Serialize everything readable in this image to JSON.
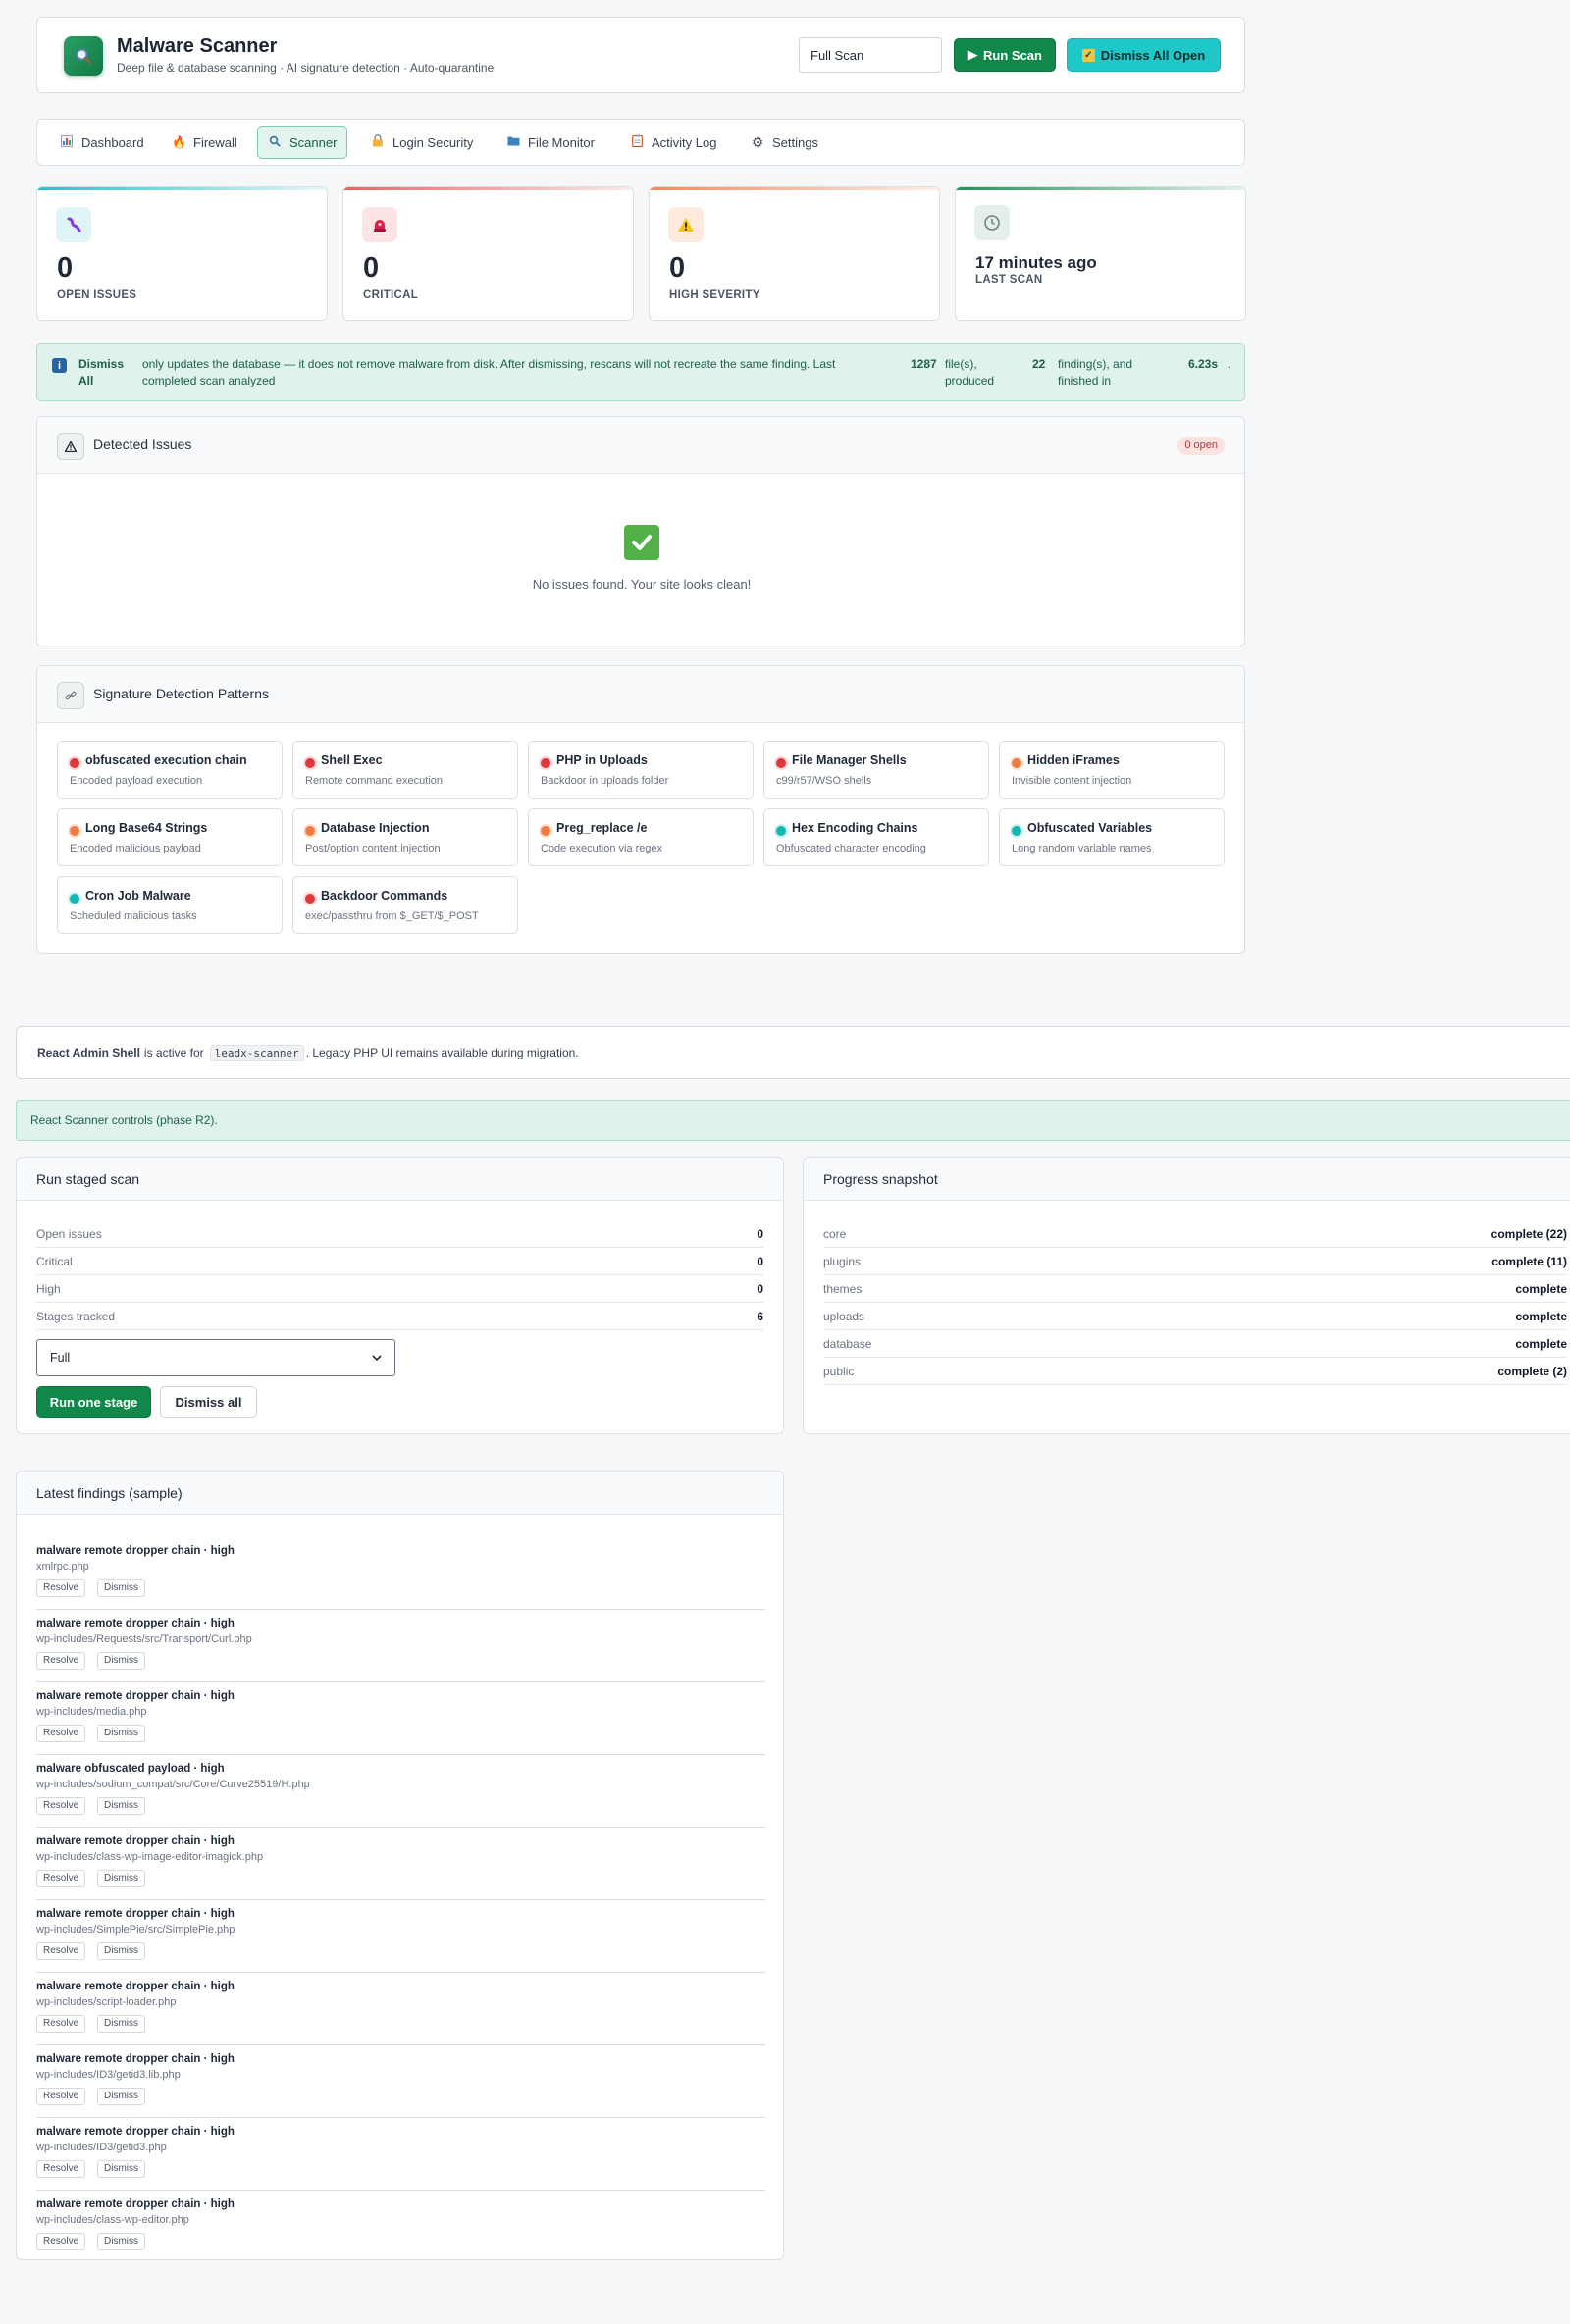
{
  "header": {
    "title": "Malware Scanner",
    "subtitle": "Deep file & database scanning · AI signature detection · Auto-quarantine",
    "scan_type_value": "Full Scan",
    "run_scan_label": "Run Scan",
    "dismiss_all_open_label": "Dismiss All Open"
  },
  "tabs": [
    {
      "label": "Dashboard",
      "icon": "chart-icon",
      "active": false
    },
    {
      "label": "Firewall",
      "icon": "fire-icon",
      "active": false
    },
    {
      "label": "Scanner",
      "icon": "search-icon",
      "active": true
    },
    {
      "label": "Login Security",
      "icon": "lock-icon",
      "active": false
    },
    {
      "label": "File Monitor",
      "icon": "folder-icon",
      "active": false
    },
    {
      "label": "Activity Log",
      "icon": "clipboard-icon",
      "active": false
    },
    {
      "label": "Settings",
      "icon": "gear-icon",
      "active": false
    }
  ],
  "stats": [
    {
      "value": "0",
      "label": "OPEN ISSUES",
      "accent": "#20c4cf"
    },
    {
      "value": "0",
      "label": "CRITICAL",
      "accent": "#e86464"
    },
    {
      "value": "0",
      "label": "HIGH SEVERITY",
      "accent": "#f08a5d"
    },
    {
      "value": "17 minutes ago",
      "label": "LAST SCAN",
      "accent": "#23915a"
    }
  ],
  "banner": {
    "lead": "Dismiss All",
    "text": "only updates the database — it does not remove malware from disk. After dismissing, rescans will not recreate the same finding. Last completed scan analyzed",
    "files_count": "1287",
    "files_text": "file(s), produced",
    "findings_count": "22",
    "findings_text": "finding(s), and finished in",
    "duration": "6.23s",
    "end": "."
  },
  "issues": {
    "title": "Detected Issues",
    "badge": "0 open",
    "empty_text": "No issues found. Your site looks clean!"
  },
  "patterns": {
    "title": "Signature Detection Patterns",
    "items": [
      {
        "name": "obfuscated execution chain",
        "desc": "Encoded payload execution",
        "severity": "critical"
      },
      {
        "name": "Shell Exec",
        "desc": "Remote command execution",
        "severity": "critical"
      },
      {
        "name": "PHP in Uploads",
        "desc": "Backdoor in uploads folder",
        "severity": "critical"
      },
      {
        "name": "File Manager Shells",
        "desc": "c99/r57/WSO shells",
        "severity": "critical"
      },
      {
        "name": "Hidden iFrames",
        "desc": "Invisible content injection",
        "severity": "high"
      },
      {
        "name": "Long Base64 Strings",
        "desc": "Encoded malicious payload",
        "severity": "high"
      },
      {
        "name": "Database Injection",
        "desc": "Post/option content injection",
        "severity": "high"
      },
      {
        "name": "Preg_replace /e",
        "desc": "Code execution via regex",
        "severity": "high"
      },
      {
        "name": "Hex Encoding Chains",
        "desc": "Obfuscated character encoding",
        "severity": "medium"
      },
      {
        "name": "Obfuscated Variables",
        "desc": "Long random variable names",
        "severity": "medium"
      },
      {
        "name": "Cron Job Malware",
        "desc": "Scheduled malicious tasks",
        "severity": "medium"
      },
      {
        "name": "Backdoor Commands",
        "desc": "exec/passthru from $_GET/$_POST",
        "severity": "critical"
      }
    ]
  },
  "react_shell": {
    "strong": "React Admin Shell",
    "mid": "is active for",
    "code": "leadx-scanner",
    "tail": ". Legacy PHP UI remains available during migration."
  },
  "phase_note": "React Scanner controls (phase R2).",
  "staged_scan": {
    "title": "Run staged scan",
    "rows": [
      {
        "key": "Open issues",
        "value": "0"
      },
      {
        "key": "Critical",
        "value": "0"
      },
      {
        "key": "High",
        "value": "0"
      },
      {
        "key": "Stages tracked",
        "value": "6"
      }
    ],
    "select_value": "Full",
    "run_one_stage_label": "Run one stage",
    "dismiss_all_label": "Dismiss all"
  },
  "progress": {
    "title": "Progress snapshot",
    "rows": [
      {
        "key": "core",
        "value": "complete (22)"
      },
      {
        "key": "plugins",
        "value": "complete (11)"
      },
      {
        "key": "themes",
        "value": "complete"
      },
      {
        "key": "uploads",
        "value": "complete"
      },
      {
        "key": "database",
        "value": "complete"
      },
      {
        "key": "public",
        "value": "complete (2)"
      }
    ]
  },
  "findings": {
    "title": "Latest findings (sample)",
    "resolve_label": "Resolve",
    "dismiss_label": "Dismiss",
    "items": [
      {
        "title": "malware remote dropper chain · high",
        "path": "xmlrpc.php"
      },
      {
        "title": "malware remote dropper chain · high",
        "path": "wp-includes/Requests/src/Transport/Curl.php"
      },
      {
        "title": "malware remote dropper chain · high",
        "path": "wp-includes/media.php"
      },
      {
        "title": "malware obfuscated payload · high",
        "path": "wp-includes/sodium_compat/src/Core/Curve25519/H.php"
      },
      {
        "title": "malware remote dropper chain · high",
        "path": "wp-includes/class-wp-image-editor-imagick.php"
      },
      {
        "title": "malware remote dropper chain · high",
        "path": "wp-includes/SimplePie/src/SimplePie.php"
      },
      {
        "title": "malware remote dropper chain · high",
        "path": "wp-includes/script-loader.php"
      },
      {
        "title": "malware remote dropper chain · high",
        "path": "wp-includes/ID3/getid3.lib.php"
      },
      {
        "title": "malware remote dropper chain · high",
        "path": "wp-includes/ID3/getid3.php"
      },
      {
        "title": "malware remote dropper chain · high",
        "path": "wp-includes/class-wp-editor.php"
      }
    ]
  }
}
